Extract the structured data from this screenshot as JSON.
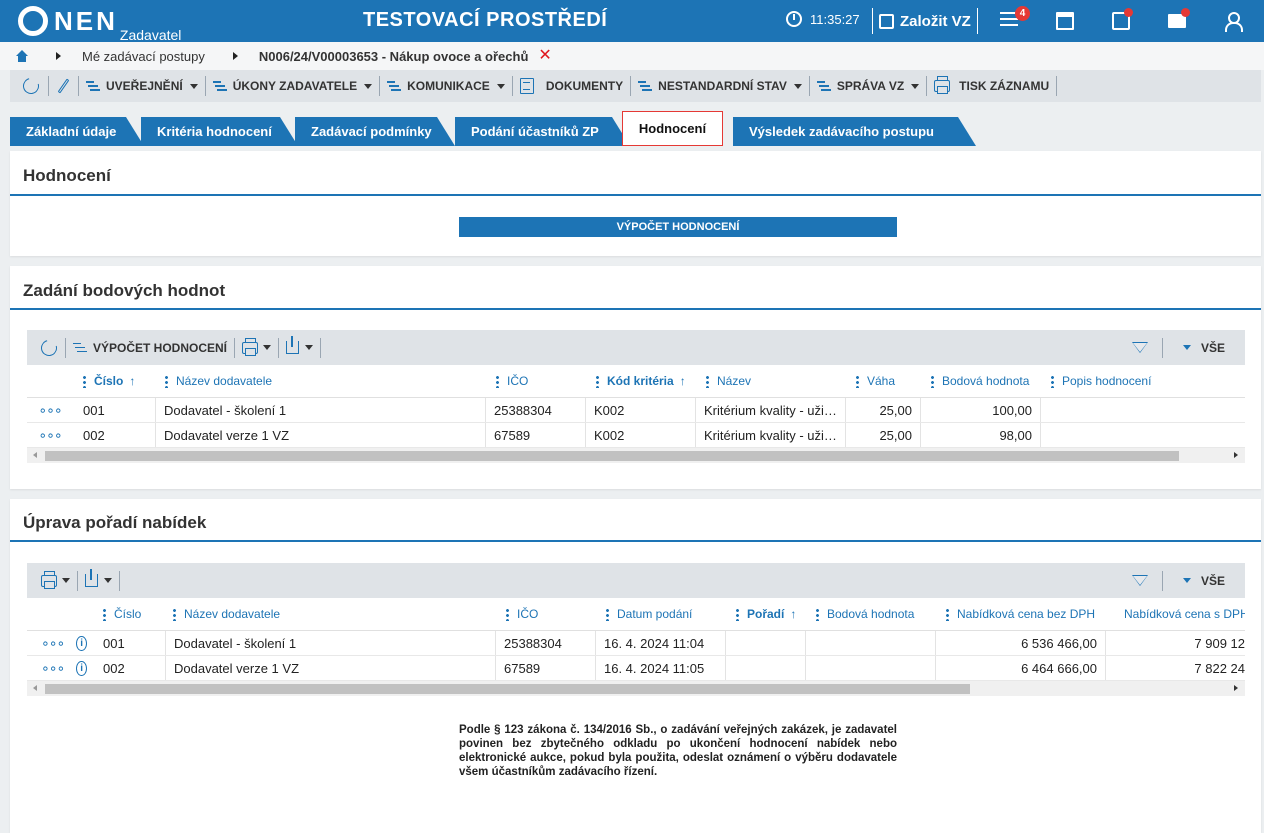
{
  "header": {
    "logo_text": "NEN",
    "logo_sub": "Zadavatel",
    "title": "TESTOVACÍ PROSTŘEDÍ",
    "time": "11:35:27",
    "create_label": "Založit VZ",
    "menu_badge": "4",
    "accent": "#1d74b5",
    "alert_color": "#e53935"
  },
  "breadcrumb": {
    "items": [
      "Mé zadávací postupy",
      "N006/24/V00003653 - Nákup ovoce a ořechů"
    ]
  },
  "toolbar": {
    "uverejneni": "UVEŘEJNĚNÍ",
    "ukony": "ÚKONY ZADAVATELE",
    "komunikace": "KOMUNIKACE",
    "dokumenty": "DOKUMENTY",
    "nestandardni": "NESTANDARDNÍ STAV",
    "sprava": "SPRÁVA VZ",
    "tisk": "TISK ZÁZNAMU"
  },
  "tabs": [
    "Základní údaje",
    "Kritéria hodnocení",
    "Zadávací podmínky",
    "Podání účastníků ZP",
    "Hodnocení",
    "Výsledek zadávacího postupu"
  ],
  "section1": {
    "title": "Hodnocení",
    "button": "VÝPOČET HODNOCENÍ"
  },
  "section2": {
    "title": "Zadání bodových hodnot",
    "toolbar_calc": "VÝPOČET HODNOCENÍ",
    "filter_all": "VŠE",
    "columns": [
      "Číslo",
      "Název dodavatele",
      "IČO",
      "Kód kritéria",
      "Název",
      "Váha",
      "Bodová hodnota",
      "Popis hodnocení"
    ],
    "rows": [
      [
        "001",
        "Dodavatel - školení 1",
        "25388304",
        "K002",
        "Kritérium kvality - uži…",
        "25,00",
        "100,00",
        ""
      ],
      [
        "002",
        "Dodavatel verze 1 VZ",
        "67589",
        "K002",
        "Kritérium kvality - uži…",
        "25,00",
        "98,00",
        ""
      ]
    ]
  },
  "section3": {
    "title": "Úprava pořadí nabídek",
    "filter_all": "VŠE",
    "columns": [
      "Číslo",
      "Název dodavatele",
      "IČO",
      "Datum podání",
      "Pořadí",
      "Bodová hodnota",
      "Nabídková cena bez DPH",
      "Nabídková cena s DPH"
    ],
    "rows": [
      [
        "001",
        "Dodavatel - školení 1",
        "25388304",
        "16. 4. 2024 11:04",
        "",
        "",
        "6 536 466,00",
        "7 909 12"
      ],
      [
        "002",
        "Dodavatel verze 1 VZ",
        "67589",
        "16. 4. 2024 11:05",
        "",
        "",
        "6 464 666,00",
        "7 822 24"
      ]
    ]
  },
  "notice": "Podle § 123 zákona č. 134/2016 Sb., o zadávání veřejných zakázek, je zadavatel povinen bez zbytečného odkladu po ukončení hodnocení nabídek nebo elektronické aukce, pokud byla použita, odeslat oznámení o výběru dodavatele všem účastníkům zadávacího řízení."
}
